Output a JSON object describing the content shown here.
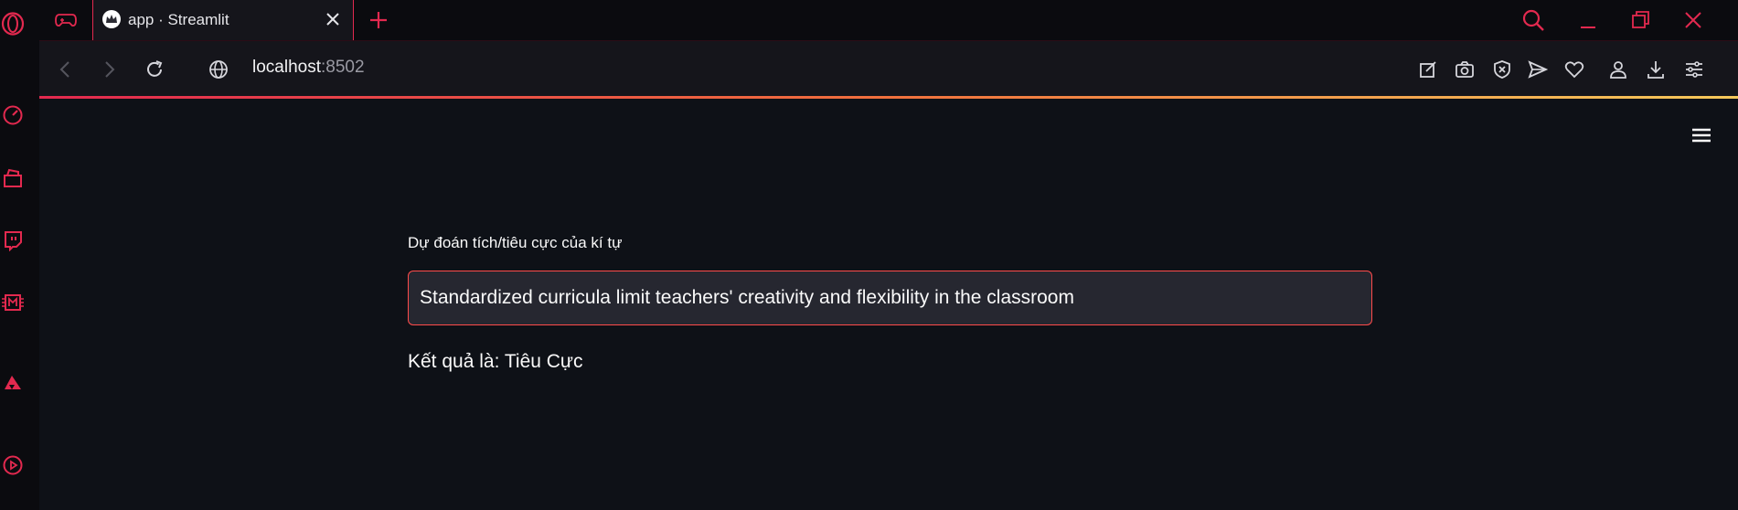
{
  "browser": {
    "tabs": [
      {
        "title": "app · Streamlit",
        "active": true,
        "favicon": "crown-icon"
      }
    ],
    "address": {
      "host": "localhost",
      "port": ":8502"
    },
    "accent_colors": [
      "#e3294f",
      "#f0703d",
      "#f5c85a"
    ]
  },
  "sidebar": {
    "icons": [
      "opera-logo-icon",
      "speed-dial-icon",
      "store-icon",
      "twitch-icon",
      "m-chip-icon",
      "aria-icon",
      "player-icon"
    ]
  },
  "toolbar": {
    "icons": [
      "easy-setup-icon",
      "snapshot-icon",
      "adblock-icon",
      "send-icon",
      "heart-icon",
      "profile-icon",
      "download-icon",
      "settings-icon"
    ]
  },
  "app": {
    "input_label": "Dự đoán tích/tiêu cực của kí tự",
    "input_value": "Standardized curricula limit teachers' creativity and flexibility in the classroom",
    "result_text": "Kết quả là: Tiêu Cực"
  },
  "theme": {
    "primary": "#ff4b4b",
    "background": "#0e1117",
    "input_bg": "#262730"
  }
}
